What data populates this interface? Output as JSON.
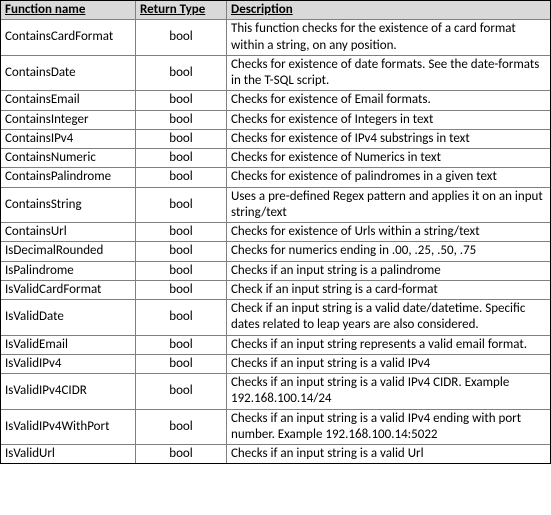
{
  "table": {
    "headers": {
      "name": "Function name",
      "type": "Return Type",
      "desc": "Description"
    },
    "rows": [
      {
        "name": "ContainsCardFormat",
        "type": "bool",
        "desc": "This function checks for the existence of a card format within a string, on any position."
      },
      {
        "name": "ContainsDate",
        "type": "bool",
        "desc": "Checks for existence of date formats. See the date-formats in the T-SQL script."
      },
      {
        "name": "ContainsEmail",
        "type": "bool",
        "desc": "Checks for existence of Email formats."
      },
      {
        "name": "ContainsInteger",
        "type": "bool",
        "desc": "Checks for existence of Integers in text"
      },
      {
        "name": "ContainsIPv4",
        "type": "bool",
        "desc": "Checks for existence of IPv4 substrings in text"
      },
      {
        "name": "ContainsNumeric",
        "type": "bool",
        "desc": "Checks for existence of Numerics in text"
      },
      {
        "name": "ContainsPalindrome",
        "type": "bool",
        "desc": "Checks for existence of palindromes in a given text"
      },
      {
        "name": "ContainsString",
        "type": "bool",
        "desc": "Uses a pre-defined Regex pattern and applies it on an input string/text"
      },
      {
        "name": "ContainsUrl",
        "type": "bool",
        "desc": "Checks for existence of Urls within a string/text"
      },
      {
        "name": "IsDecimalRounded",
        "type": "bool",
        "desc": "Checks for numerics ending in .00, .25, .50, .75"
      },
      {
        "name": "IsPalindrome",
        "type": "bool",
        "desc": "Checks if an input string is a palindrome"
      },
      {
        "name": "IsValidCardFormat",
        "type": "bool",
        "desc": "Check if an input string is a card-format"
      },
      {
        "name": "IsValidDate",
        "type": "bool",
        "desc": "Check if an input string is a valid date/datetime. Specific dates related to leap years are also considered."
      },
      {
        "name": "IsValidEmail",
        "type": "bool",
        "desc": "Checks if an input string represents a valid email format."
      },
      {
        "name": "IsValidIPv4",
        "type": "bool",
        "desc": "Checks if an input string is a valid IPv4"
      },
      {
        "name": "IsValidIPv4CIDR",
        "type": "bool",
        "desc": "Checks if an input string is a valid IPv4 CIDR. Example 192.168.100.14/24"
      },
      {
        "name": "IsValidIPv4WithPort",
        "type": "bool",
        "desc": "Checks if an input string is a valid IPv4 ending with port number. Example 192.168.100.14:5022"
      },
      {
        "name": "IsValidUrl",
        "type": "bool",
        "desc": "Checks if an input string is a valid Url"
      }
    ]
  }
}
